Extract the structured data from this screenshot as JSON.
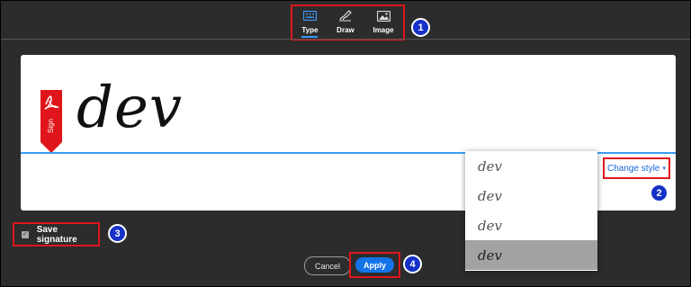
{
  "tabs": [
    {
      "label": "Type",
      "icon": "keyboard-icon",
      "active": true
    },
    {
      "label": "Draw",
      "icon": "pen-draw-icon",
      "active": false
    },
    {
      "label": "Image",
      "icon": "image-icon",
      "active": false
    }
  ],
  "markers": [
    "1",
    "2",
    "3",
    "4"
  ],
  "signature": {
    "tag_label": "Sign",
    "text": "dev",
    "change_style_label": "Change style"
  },
  "style_options": [
    "dev",
    "dev",
    "dev",
    "dev"
  ],
  "selected_style_index": 3,
  "save_signature": {
    "label": "Save signature",
    "checked": true
  },
  "buttons": {
    "cancel": "Cancel",
    "apply": "Apply"
  },
  "colors": {
    "accent": "#1473e6",
    "highlight_box": "#e0151b",
    "marker": "#1531c7",
    "background": "#2c2c2c"
  }
}
